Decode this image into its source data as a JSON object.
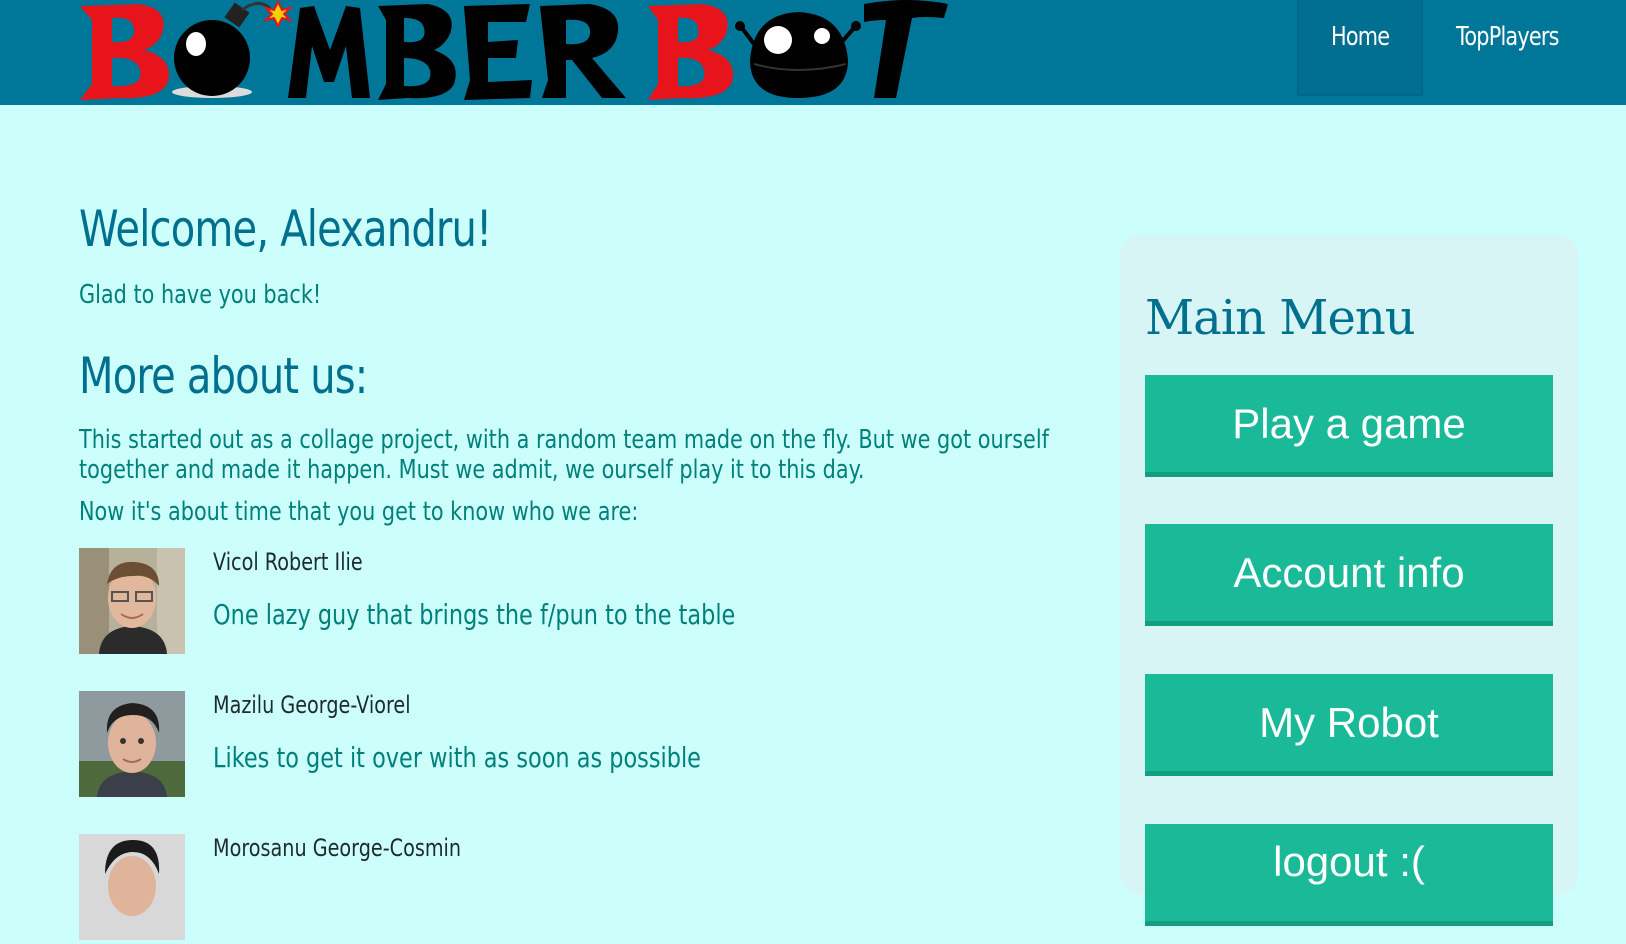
{
  "header": {
    "logo_text": "BOMBERBOT",
    "nav": {
      "home": "Home",
      "top_players": "TopPlayers"
    }
  },
  "main": {
    "welcome": "Welcome, Alexandru!",
    "glad": "Glad to have you back!",
    "more_title": "More about us:",
    "intro_line1": "This started out as a collage project, with a random team made on the fly. But we got ourself",
    "intro_line2": "together and made it happen. Must we admit, we ourself play it to this day.",
    "intro_line3": "Now it's about time that you get to know who we are:",
    "members": [
      {
        "name": "Vicol Robert Ilie",
        "desc": "One lazy guy that brings the f/pun to the table"
      },
      {
        "name": "Mazilu George-Viorel",
        "desc": "Likes to get it over with as soon as possible"
      },
      {
        "name": "Morosanu George-Cosmin",
        "desc": ""
      }
    ]
  },
  "sidebar": {
    "title": "Main Menu",
    "buttons": [
      "Play a game",
      "Account info",
      "My Robot",
      "logout :("
    ]
  },
  "colors": {
    "header_bg": "#007698",
    "page_bg": "#ccfffb",
    "heading": "#00708e",
    "text": "#00807c",
    "button": "#1ab997",
    "sidebar_bg": "#d6f5f4"
  }
}
